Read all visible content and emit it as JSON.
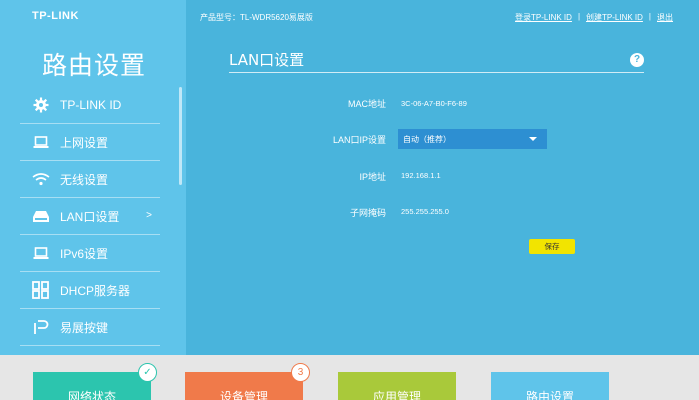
{
  "header": {
    "logo": "TP-LINK",
    "model": "产品型号：TL-WDR5620易展版",
    "links": [
      "登录TP-LINK ID",
      "|",
      "创建TP-LINK ID",
      "|",
      "退出"
    ]
  },
  "sidebar": {
    "title": "路由设置",
    "items": [
      {
        "label": "TP-LINK ID",
        "icon": "gear-icon"
      },
      {
        "label": "上网设置",
        "icon": "laptop-icon"
      },
      {
        "label": "无线设置",
        "icon": "wifi-icon"
      },
      {
        "label": "LAN口设置",
        "icon": "router-icon",
        "arrow": ">"
      },
      {
        "label": "IPv6设置",
        "icon": "laptop-icon"
      },
      {
        "label": "DHCP服务器",
        "icon": "dhcp-icon"
      },
      {
        "label": "易展按键",
        "icon": "easy-button-icon"
      }
    ]
  },
  "content": {
    "title": "LAN口设置",
    "help": "?",
    "mac_label": "MAC地址",
    "mac_value": "3C-06-A7-B0-F6-89",
    "ip_setting_label": "LAN口IP设置",
    "ip_setting_value": "自动（推荐）",
    "ip_label": "IP地址",
    "ip_value": "192.168.1.1",
    "mask_label": "子网掩码",
    "mask_value": "255.255.255.0",
    "save_label": "保存"
  },
  "bottom_tabs": [
    {
      "label": "网络状态",
      "color": "#2cc5ae",
      "badge": "✓"
    },
    {
      "label": "设备管理",
      "color": "#f07a4a",
      "badge": "3"
    },
    {
      "label": "应用管理",
      "color": "#a9c93a"
    },
    {
      "label": "路由设置",
      "color": "#5fc4ea"
    }
  ],
  "colors": {
    "main_bg": "#49b4dc",
    "sidebar_bg": "#5fc4ea",
    "select_bg": "#2d8fd2",
    "save_bg": "#f2e400"
  }
}
